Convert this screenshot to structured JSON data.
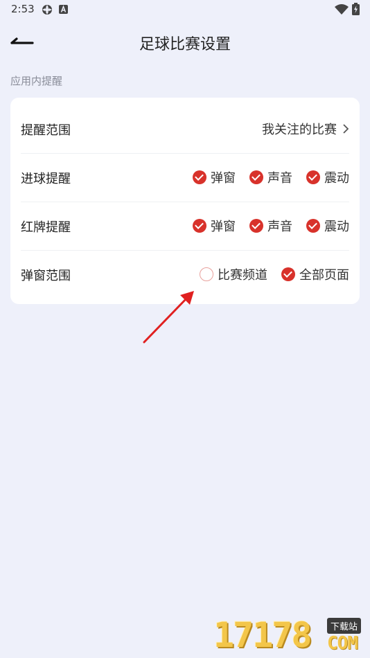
{
  "status_bar": {
    "time": "2:53",
    "icons": [
      "settings-gear-icon",
      "a-box-icon",
      "wifi-icon",
      "battery-charging-icon"
    ]
  },
  "header": {
    "title": "足球比赛设置",
    "back_icon": "back-arrow-icon"
  },
  "section": {
    "label": "应用内提醒"
  },
  "rows": [
    {
      "label": "提醒范围",
      "value": "我关注的比赛"
    },
    {
      "label": "进球提醒",
      "options": [
        {
          "label": "弹窗",
          "checked": true
        },
        {
          "label": "声音",
          "checked": true
        },
        {
          "label": "震动",
          "checked": true
        }
      ]
    },
    {
      "label": "红牌提醒",
      "options": [
        {
          "label": "弹窗",
          "checked": true
        },
        {
          "label": "声音",
          "checked": true
        },
        {
          "label": "震动",
          "checked": true
        }
      ]
    },
    {
      "label": "弹窗范围",
      "options": [
        {
          "label": "比赛频道",
          "checked": false
        },
        {
          "label": "全部页面",
          "checked": true
        }
      ]
    }
  ],
  "colors": {
    "accent": "#d8322b",
    "background": "#eef0fa",
    "card": "#ffffff",
    "annotation_arrow": "#e02020"
  },
  "watermark": {
    "number": "17178",
    "tag": "下载站",
    "suffix": "COM"
  }
}
